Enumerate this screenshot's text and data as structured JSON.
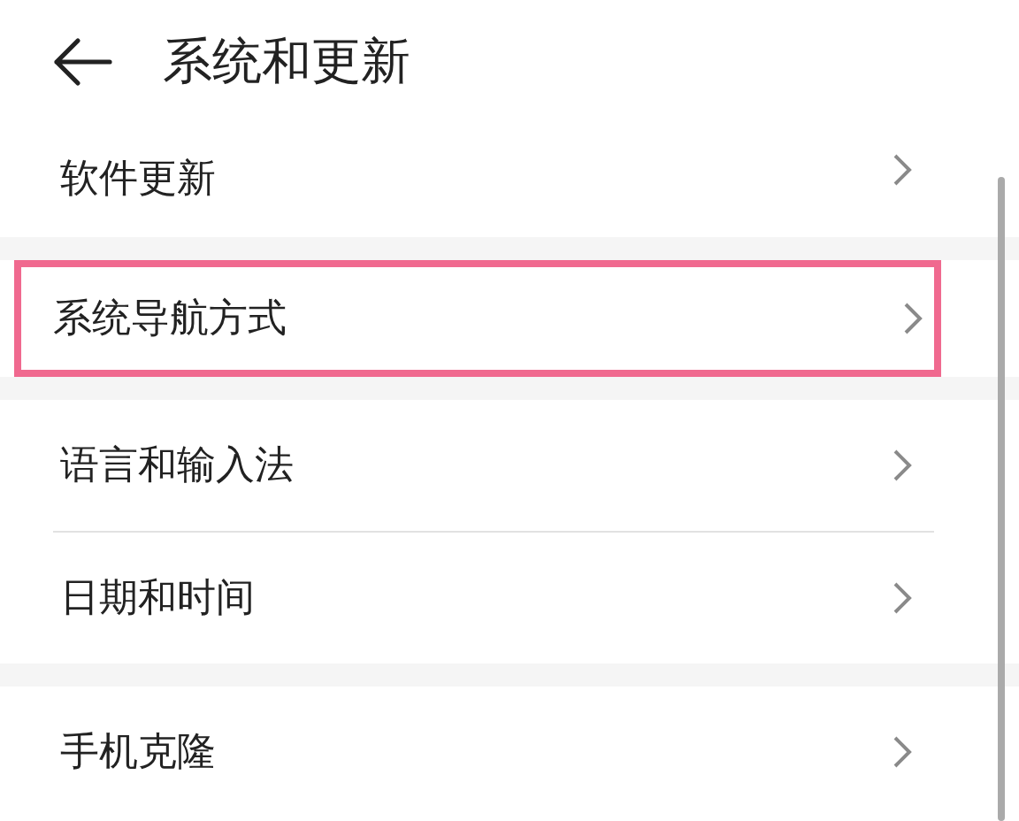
{
  "header": {
    "title": "系统和更新"
  },
  "groups": [
    {
      "items": [
        {
          "label": "软件更新",
          "highlighted": false
        }
      ]
    },
    {
      "items": [
        {
          "label": "系统导航方式",
          "highlighted": true
        }
      ]
    },
    {
      "items": [
        {
          "label": "语言和输入法",
          "highlighted": false
        },
        {
          "label": "日期和时间",
          "highlighted": false
        }
      ]
    },
    {
      "items": [
        {
          "label": "手机克隆",
          "highlighted": false
        }
      ]
    }
  ]
}
